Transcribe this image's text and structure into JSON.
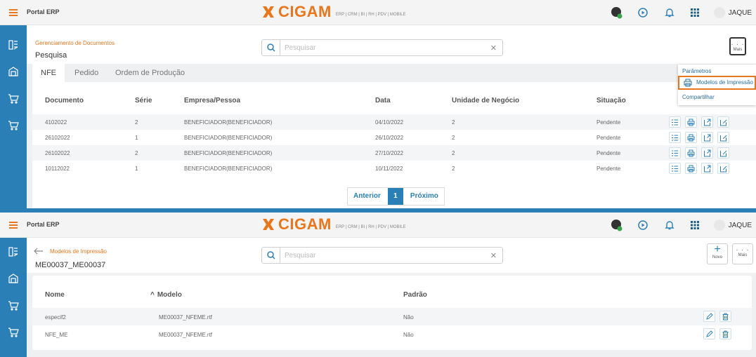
{
  "app": {
    "title": "Portal ERP",
    "logo_text": "CIGAM",
    "logo_tagline": "ERP | CRM | BI | RH | PDV | MOBILE",
    "user": "JAQUE"
  },
  "colors": {
    "accent": "#e8761c",
    "primary": "#2a7fb6"
  },
  "icons": {
    "topbar": [
      "chat-bubble-icon",
      "play-circle-icon",
      "bell-icon",
      "apps-grid-icon",
      "avatar-icon"
    ],
    "sidebar": [
      "report-icon",
      "warehouse-icon",
      "cart-icon",
      "cart-icon"
    ]
  },
  "screen1": {
    "breadcrumb": "Gerenciamento de Documentos",
    "page_title": "Pesquisa",
    "search_placeholder": "Pesquisar",
    "more": {
      "dots": "· · ·",
      "label": "Mais"
    },
    "tabs": [
      "NFE",
      "Pedido",
      "Ordem de Produção"
    ],
    "columns": [
      "Documento",
      "Série",
      "Empresa/Pessoa",
      "Data",
      "Unidade de Negócio",
      "Situação"
    ],
    "rows": [
      [
        "4102022",
        "2",
        "BENEFICIADOR(BENEFICIADOR)",
        "04/10/2022",
        "2",
        "Pendente"
      ],
      [
        "26102022",
        "1",
        "BENEFICIADOR(BENEFICIADOR)",
        "26/10/2022",
        "2",
        "Pendente"
      ],
      [
        "26102022",
        "2",
        "BENEFICIADOR(BENEFICIADOR)",
        "27/10/2022",
        "2",
        "Pendente"
      ],
      [
        "10112022",
        "1",
        "BENEFICIADOR(BENEFICIADOR)",
        "10/11/2022",
        "2",
        "Pendente"
      ]
    ],
    "row_actions": [
      "list-icon",
      "printer-icon",
      "export-icon",
      "edit-doc-icon"
    ],
    "pager": {
      "prev": "Anterior",
      "current": "1",
      "next": "Próximo"
    },
    "menu": {
      "items": [
        "Parâmetros",
        "Modelos de Impressão",
        "Compartilhar"
      ],
      "highlighted": 1
    }
  },
  "screen2": {
    "breadcrumb": "Modelos de Impressão",
    "page_title": "ME00037_ME00037",
    "search_placeholder": "Pesquisar",
    "new": {
      "symbol": "+",
      "label": "Novo"
    },
    "more": {
      "dots": "· · ·",
      "label": "Mais"
    },
    "columns": [
      "Nome",
      "Modelo",
      "Padrão"
    ],
    "sort_indicator": "^",
    "rows": [
      [
        "especif2",
        "ME00037_NFEME.rtf",
        "Não"
      ],
      [
        "NFE_ME",
        "ME00037_NFEME.rtf",
        "Não"
      ]
    ]
  }
}
